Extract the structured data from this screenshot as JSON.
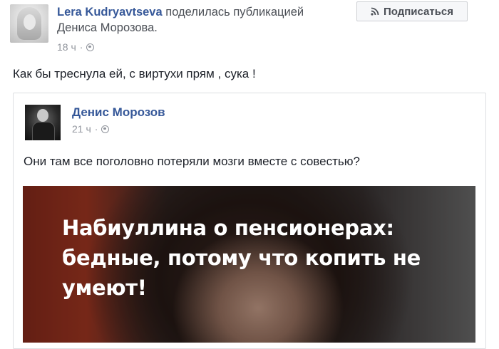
{
  "post": {
    "author": "Lera Kudryavtseva",
    "action_text": "поделилась публикацией Дениса Морозова.",
    "time": "18 ч",
    "separator": "·",
    "text": "Как бы треснула ей, с виртухи прям , сука !"
  },
  "subscribe_button": {
    "label": "Подписаться",
    "icon": "rss-icon"
  },
  "shared_post": {
    "author": "Денис Морозов",
    "time": "21 ч",
    "separator": "·",
    "text": "Они там все поголовно потеряли мозги вместе с совестью?",
    "image_headline": "Набиуллина о пенсионерах: бедные, потому что копить не умеют!"
  },
  "colors": {
    "link": "#365899",
    "meta": "#90949c",
    "text": "#1d2129"
  }
}
